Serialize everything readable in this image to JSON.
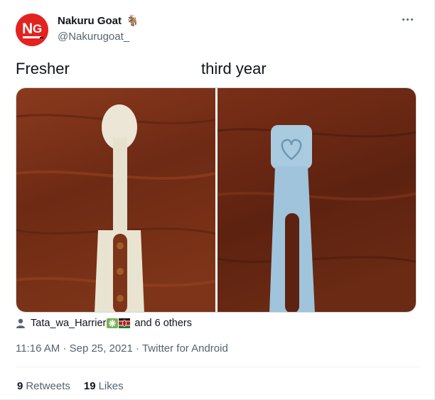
{
  "author": {
    "display_name": "Nakuru Goat",
    "display_name_emoji": "🐐",
    "handle": "@Nakurugoat_",
    "avatar_logo": "NG"
  },
  "tweet": {
    "text_left": "Fresher",
    "text_right": "third year"
  },
  "media": {
    "left_image": "white comb-like plastic clip on wooden surface",
    "right_image": "light blue plastic clip with heart emblem on wooden surface"
  },
  "likes_by": {
    "name": "Tata_wa_Harrier",
    "others": "and 6 others"
  },
  "meta": {
    "time": "11:16 AM",
    "sep1": "·",
    "date": "Sep 25, 2021",
    "sep2": "·",
    "source": "Twitter for Android"
  },
  "stats": {
    "retweets_count": "9",
    "retweets_label": "Retweets",
    "likes_count": "19",
    "likes_label": "Likes"
  },
  "colors": {
    "accent": "#1d9bf0",
    "avatar_red": "#e3231f",
    "secondary_text": "#536471"
  }
}
